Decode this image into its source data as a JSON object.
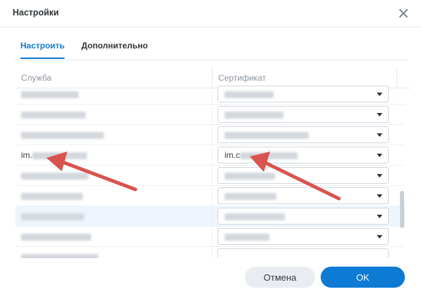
{
  "dialog": {
    "title": "Настройки"
  },
  "tabs": [
    {
      "label": "Настроить",
      "active": true
    },
    {
      "label": "Дополнительно",
      "active": false
    }
  ],
  "table": {
    "columns": [
      "Служба",
      "Сертификат"
    ],
    "rows": [
      {
        "service": "",
        "certificate": ""
      },
      {
        "service": "",
        "certificate": ""
      },
      {
        "service": "",
        "certificate": ""
      },
      {
        "service": "im.",
        "certificate": "im.c"
      },
      {
        "service": "",
        "certificate": ""
      },
      {
        "service": "",
        "certificate": ""
      },
      {
        "service": "",
        "certificate": ""
      },
      {
        "service": "",
        "certificate": ""
      }
    ]
  },
  "footer": {
    "cancel_label": "Отмена",
    "ok_label": "OK"
  },
  "colors": {
    "accent": "#0d7ad4",
    "annotation_arrow": "#d9534f"
  }
}
